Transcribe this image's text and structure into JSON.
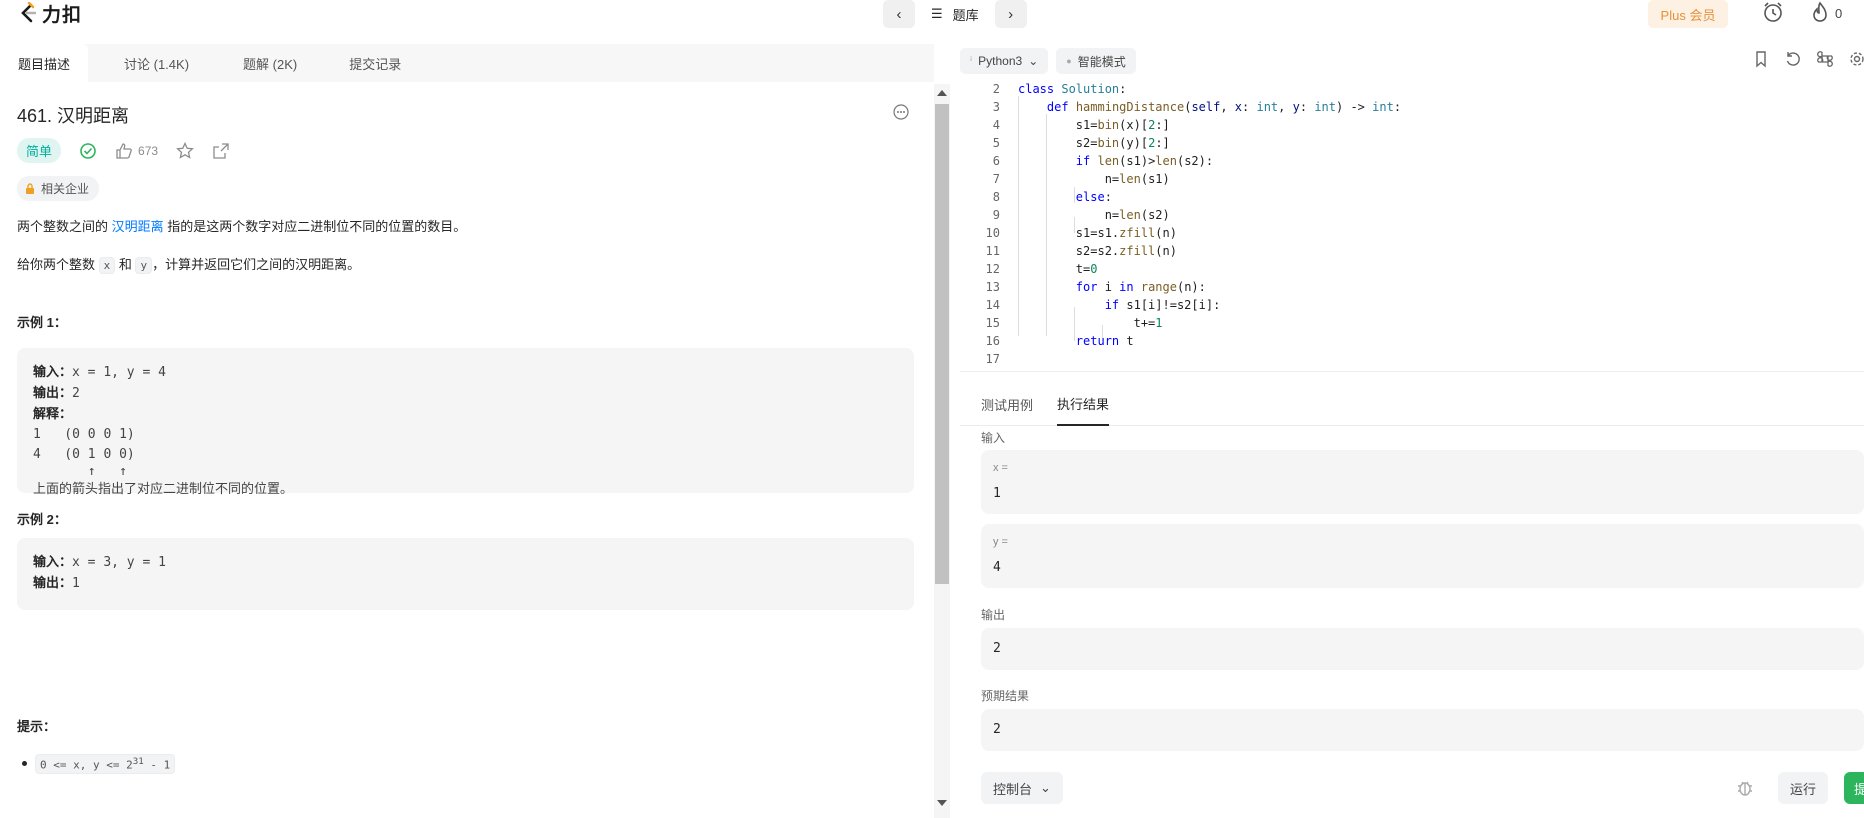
{
  "navbar": {
    "logo_text": "力扣",
    "problem_list_label": "题库",
    "plus_label": "Plus 会员",
    "streak_count": "0"
  },
  "tabs": [
    "题目描述",
    "讨论 (1.4K)",
    "题解 (2K)",
    "提交记录"
  ],
  "problem": {
    "title": "461. 汉明距离",
    "difficulty": "简单",
    "likes": "673",
    "company_label": "相关企业",
    "p1_before": "两个整数之间的 ",
    "p1_link": "汉明距离",
    "p1_after": " 指的是这两个数字对应二进制位不同的位置的数目。",
    "p2_before": "给你两个整数 ",
    "p2_x": "x",
    "p2_mid": " 和 ",
    "p2_y": "y",
    "p2_after": "，计算并返回它们之间的汉明距离。",
    "example1": {
      "title": "示例 1：",
      "input_label": "输入：",
      "input_value": "x = 1, y = 4",
      "output_label": "输出：",
      "output_value": "2",
      "explain_label": "解释：",
      "lines": [
        "1   (0 0 0 1)",
        "4   (0 1 0 0)",
        "       ↑   ↑"
      ],
      "note": "上面的箭头指出了对应二进制位不同的位置。"
    },
    "example2": {
      "title": "示例 2：",
      "input_label": "输入：",
      "input_value": "x = 3, y = 1",
      "output_label": "输出：",
      "output_value": "1"
    },
    "hint_title": "提示：",
    "hint_code": "0 <= x, y <= 2",
    "hint_sup": "31",
    "hint_tail": " - 1"
  },
  "editor": {
    "language": "Python3",
    "mode": "智能模式"
  },
  "code_lines": [
    {
      "n": "2"
    },
    {
      "n": "3"
    },
    {
      "n": "4"
    },
    {
      "n": "5"
    },
    {
      "n": "6"
    },
    {
      "n": "7"
    },
    {
      "n": "8"
    },
    {
      "n": "9"
    },
    {
      "n": "10"
    },
    {
      "n": "11"
    },
    {
      "n": "12"
    },
    {
      "n": "13"
    },
    {
      "n": "14"
    },
    {
      "n": "15"
    },
    {
      "n": "16"
    },
    {
      "n": "17"
    }
  ],
  "results": {
    "tab_testcase": "测试用例",
    "tab_result": "执行结果",
    "input_label": "输入",
    "x_key": "x =",
    "x_value": "1",
    "y_key": "y =",
    "y_value": "4",
    "output_label": "输出",
    "output_value": "2",
    "expected_label": "预期结果",
    "expected_value": "2"
  },
  "footer": {
    "console_label": "控制台",
    "run_label": "运行",
    "submit_label": "提"
  }
}
